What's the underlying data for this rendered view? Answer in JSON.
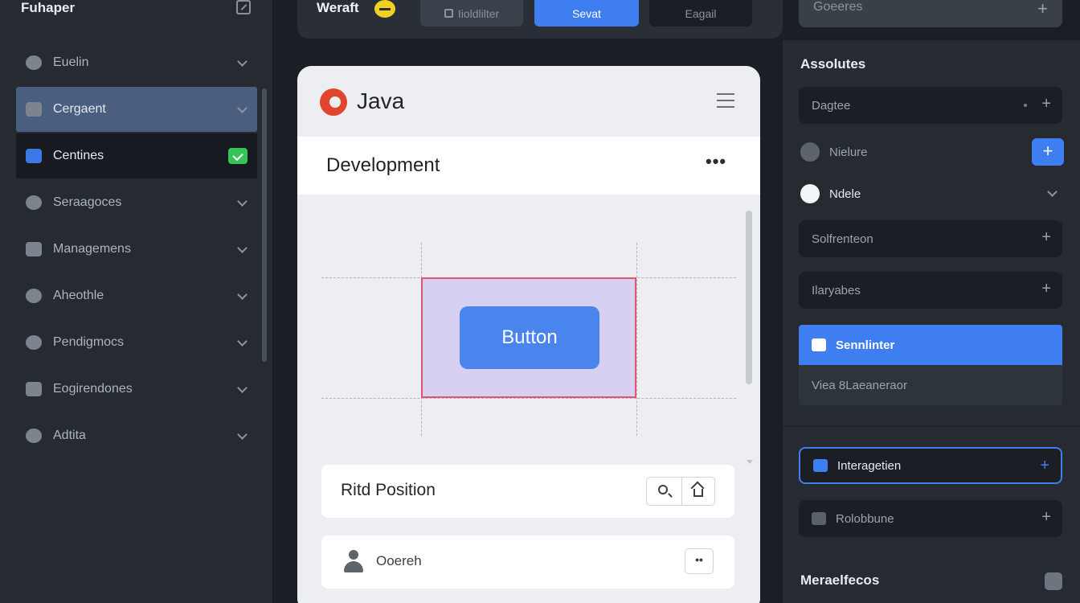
{
  "sidebar": {
    "title": "Fuhaper",
    "items": [
      {
        "label": "Euelin"
      },
      {
        "label": "Cergaent"
      },
      {
        "label": "Centines"
      },
      {
        "label": "Seraagoces"
      },
      {
        "label": "Managemens"
      },
      {
        "label": "Aheothle"
      },
      {
        "label": "Pendigmocs"
      },
      {
        "label": "Eogirendones"
      },
      {
        "label": "Adtita"
      }
    ]
  },
  "toolbar": {
    "title": "Weraft",
    "btn1": "Iioldlilter",
    "btn2": "Sevat",
    "btn3": "Eagail"
  },
  "top_search": {
    "label": "Goeeres"
  },
  "right_panel": {
    "heading": "Assolutes",
    "row_dagtee": "Dagtee",
    "row_nielure": "Nielure",
    "row_ndele": "Ndele",
    "row_solfrenteon": "Solfrenteon",
    "row_llaryabes": "Ilaryabes",
    "row_sennlinter": "Sennlinter",
    "row_viea": "Viea 8Laeaneraor",
    "row_interagetien": "Interagetien",
    "row_rolobbune": "Rolobbune",
    "footer_heading": "Meraelfecos"
  },
  "canvas": {
    "app_title": "Java",
    "section_title": "Development",
    "more_glyph": "•••",
    "button_label": "Button",
    "position_title": "Ritd Position",
    "user_name": "Ooereh",
    "user_more_glyph": "••"
  }
}
